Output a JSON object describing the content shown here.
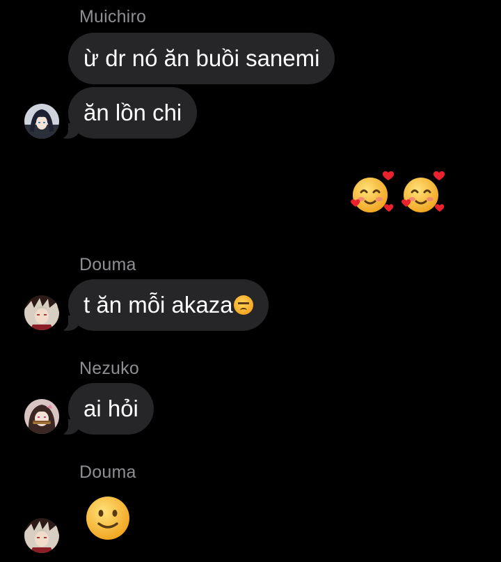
{
  "messages": [
    {
      "sender": "Muichiro",
      "bubbles": [
        "ừ dr nó ăn buồi sanemi",
        "ăn lồn chi"
      ],
      "avatar": "muichiro-avatar"
    },
    {
      "outgoing_emojis": [
        "smiling-face-with-hearts-emoji",
        "smiling-face-with-hearts-emoji"
      ]
    },
    {
      "sender": "Douma",
      "bubbles": [
        "t ăn mỗi akaza"
      ],
      "inline_emoji": "angry-face-emoji",
      "avatar": "douma-avatar"
    },
    {
      "sender": "Nezuko",
      "bubbles": [
        "ai hỏi"
      ],
      "avatar": "nezuko-avatar"
    },
    {
      "sender": "Douma",
      "emoji_message": "slightly-smiling-face-emoji",
      "avatar": "douma-avatar"
    }
  ],
  "colors": {
    "background": "#000000",
    "bubble": "#262628",
    "sender_name": "#8e8e93",
    "text": "#ffffff"
  }
}
